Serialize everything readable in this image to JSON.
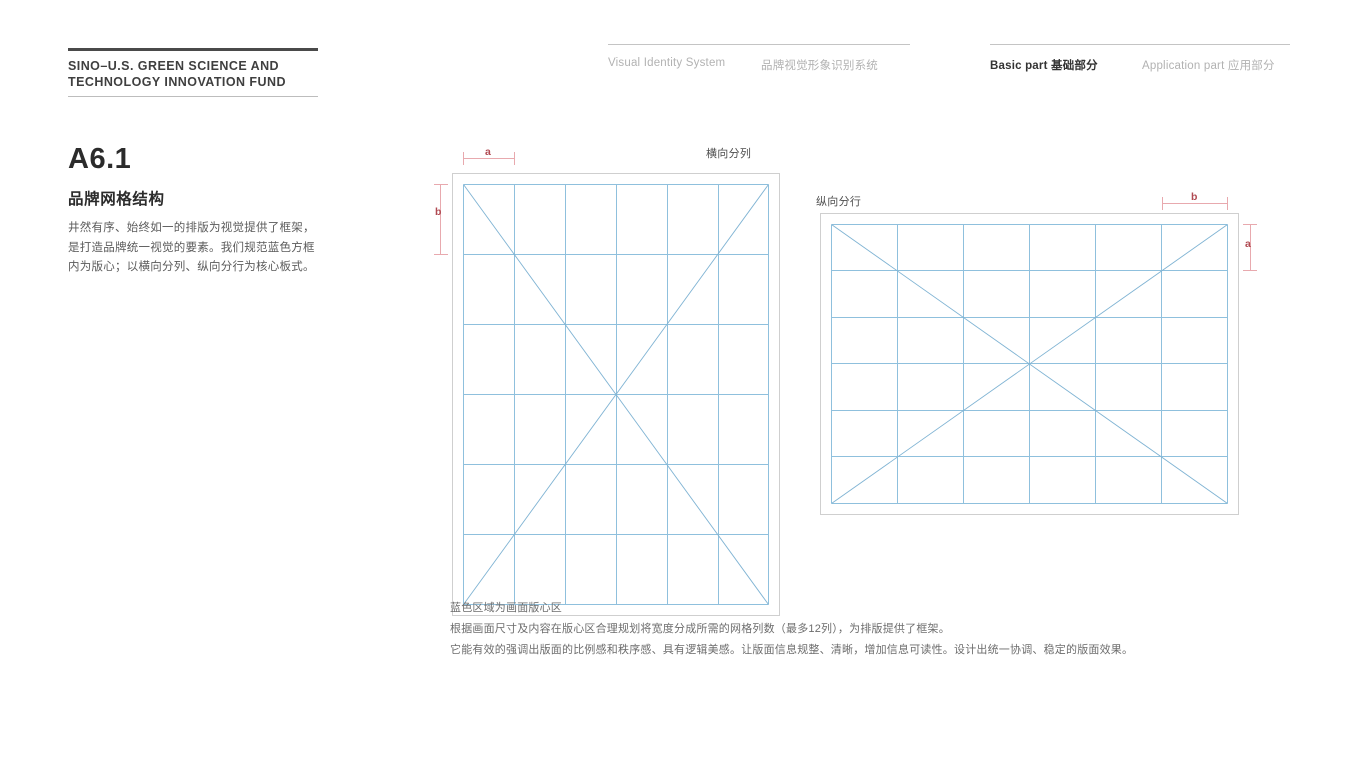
{
  "header": {
    "brand_name": "SINO–U.S. GREEN SCIENCE AND\nTECHNOLOGY INNOVATION FUND",
    "nav_left": [
      {
        "label": "Visual Identity System",
        "active": false
      },
      {
        "label": "品牌视觉形象识别系统",
        "active": false
      }
    ],
    "nav_right": [
      {
        "label": "Basic part  基础部分",
        "active": true
      },
      {
        "label": "Application part  应用部分",
        "active": false
      }
    ]
  },
  "section": {
    "code": "A6.1",
    "title": "品牌网格结构",
    "body": "井然有序、始终如一的排版为视觉提供了框架，是打造品牌统一视觉的要素。我们规范蓝色方框内为版心；以横向分列、纵向分行为核心板式。"
  },
  "diagrams": {
    "portrait": {
      "label": "横向分列",
      "columns": 6,
      "rows": 6,
      "dim_a": "a",
      "dim_b": "b"
    },
    "landscape": {
      "label": "纵向分行",
      "columns": 6,
      "rows": 6,
      "dim_a": "a",
      "dim_b": "b"
    }
  },
  "caption": {
    "lines": [
      "蓝色区域为画面版心区",
      "根据画面尺寸及内容在版心区合理规划将宽度分成所需的网格列数（最多12列），为排版提供了框架。",
      "它能有效的强调出版面的比例感和秩序感、具有逻辑美感。让版面信息规整、清晰，增加信息可读性。设计出统一协调、稳定的版面效果。"
    ]
  },
  "colors": {
    "grid_blue": "#8fc0dd",
    "diagonal_blue": "#7fb3d3",
    "frame_gray": "#cfcfcf",
    "dim_red": "#b04a52",
    "dim_rule": "#e8a9ae",
    "text_dark": "#2b2b2b",
    "text_muted": "#b2b2b2"
  }
}
